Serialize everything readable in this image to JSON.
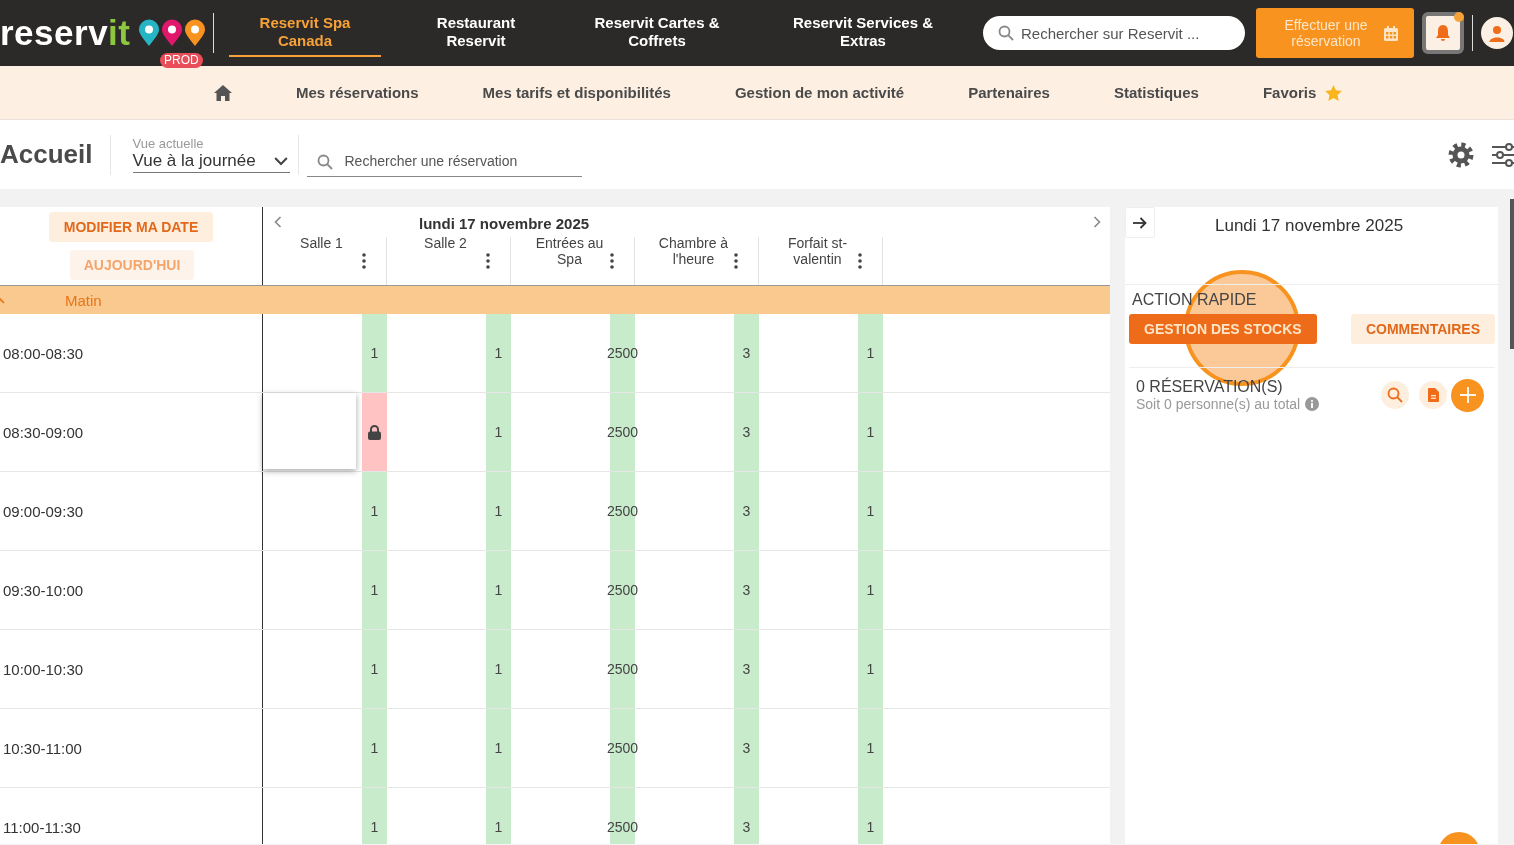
{
  "topbar": {
    "logo": {
      "text": "reserv",
      "accent": "it"
    },
    "env_badge": "PROD",
    "tabs": [
      {
        "label": "Reservit Spa\nCanada",
        "selected": true
      },
      {
        "label": "Restaurant\nReservit",
        "selected": false
      },
      {
        "label": "Reservit Cartes &\nCoffrets",
        "selected": false
      },
      {
        "label": "Reservit Services &\nExtras",
        "selected": false
      }
    ],
    "search": {
      "placeholder": "Rechercher sur Reservit ..."
    },
    "book_button": "Effectuer une\nréservation",
    "notifications": {
      "unread": true
    }
  },
  "menu": {
    "items": [
      {
        "label": "Mes réservations",
        "kind": "link"
      },
      {
        "label": "Mes tarifs et disponibilités",
        "kind": "link"
      },
      {
        "label": "Gestion de mon activité",
        "kind": "link"
      },
      {
        "label": "Partenaires",
        "kind": "link"
      },
      {
        "label": "Statistiques",
        "kind": "link"
      },
      {
        "label": "Favoris",
        "kind": "favorites"
      }
    ]
  },
  "toolbar": {
    "title": "Accueil",
    "view": {
      "label": "Vue actuelle",
      "value": "Vue à la journée"
    },
    "search": {
      "placeholder": "Rechercher une réservation"
    }
  },
  "planning": {
    "change_date": "MODIFIER MA DATE",
    "today": "AUJOURD'HUI",
    "date": "lundi 17 novembre 2025",
    "columns": [
      "Salle 1",
      "Salle 2",
      "Entrées au\nSpa",
      "Chambre à\nl'heure",
      "Forfait st-\nvalentin"
    ],
    "section": {
      "label": "Matin",
      "expanded": true
    },
    "rows": [
      {
        "time": "08:00-08:30",
        "cells": [
          {
            "value": "1",
            "locked": false,
            "card": false
          },
          {
            "value": "1",
            "locked": false,
            "card": false
          },
          {
            "value": "2500",
            "locked": false,
            "card": false
          },
          {
            "value": "3",
            "locked": false,
            "card": false
          },
          {
            "value": "1",
            "locked": false,
            "card": false
          }
        ]
      },
      {
        "time": "08:30-09:00",
        "cells": [
          {
            "locked": true,
            "card": true
          },
          {
            "value": "1",
            "locked": false,
            "card": false
          },
          {
            "value": "2500",
            "locked": false,
            "card": false
          },
          {
            "value": "3",
            "locked": false,
            "card": false
          },
          {
            "value": "1",
            "locked": false,
            "card": false
          }
        ]
      },
      {
        "time": "09:00-09:30",
        "cells": [
          {
            "value": "1",
            "locked": false,
            "card": false
          },
          {
            "value": "1",
            "locked": false,
            "card": false
          },
          {
            "value": "2500",
            "locked": false,
            "card": false
          },
          {
            "value": "3",
            "locked": false,
            "card": false
          },
          {
            "value": "1",
            "locked": false,
            "card": false
          }
        ]
      },
      {
        "time": "09:30-10:00",
        "cells": [
          {
            "value": "1",
            "locked": false,
            "card": false
          },
          {
            "value": "1",
            "locked": false,
            "card": false
          },
          {
            "value": "2500",
            "locked": false,
            "card": false
          },
          {
            "value": "3",
            "locked": false,
            "card": false
          },
          {
            "value": "1",
            "locked": false,
            "card": false
          }
        ]
      },
      {
        "time": "10:00-10:30",
        "cells": [
          {
            "value": "1",
            "locked": false,
            "card": false
          },
          {
            "value": "1",
            "locked": false,
            "card": false
          },
          {
            "value": "2500",
            "locked": false,
            "card": false
          },
          {
            "value": "3",
            "locked": false,
            "card": false
          },
          {
            "value": "1",
            "locked": false,
            "card": false
          }
        ]
      },
      {
        "time": "10:30-11:00",
        "cells": [
          {
            "value": "1",
            "locked": false,
            "card": false
          },
          {
            "value": "1",
            "locked": false,
            "card": false
          },
          {
            "value": "2500",
            "locked": false,
            "card": false
          },
          {
            "value": "3",
            "locked": false,
            "card": false
          },
          {
            "value": "1",
            "locked": false,
            "card": false
          }
        ]
      },
      {
        "time": "11:00-11:30",
        "cells": [
          {
            "value": "1",
            "locked": false,
            "card": false
          },
          {
            "value": "1",
            "locked": false,
            "card": false
          },
          {
            "value": "2500",
            "locked": false,
            "card": false
          },
          {
            "value": "3",
            "locked": false,
            "card": false
          },
          {
            "value": "1",
            "locked": false,
            "card": false
          }
        ]
      }
    ]
  },
  "side": {
    "date": "Lundi 17 novembre 2025",
    "quick_action_title": "ACTION RAPIDE",
    "actions": [
      {
        "label": "GESTION DES STOCKS",
        "selected": true
      },
      {
        "label": "COMMENTAIRES",
        "selected": false
      }
    ],
    "reservations_count": "0 RÉSERVATION(S)",
    "reservations_total": "Soit 0 personne(s) au total"
  }
}
